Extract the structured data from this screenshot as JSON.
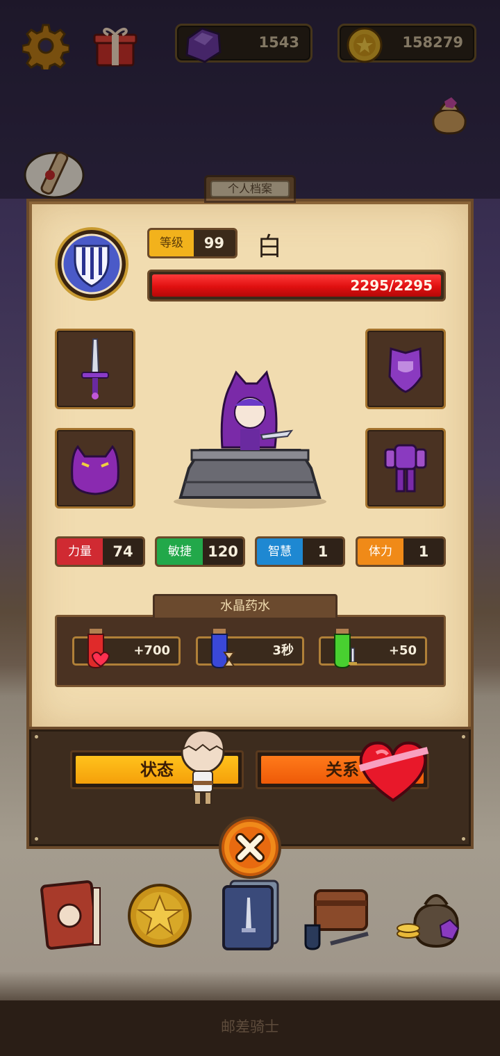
{
  "resources": {
    "gems": "1543",
    "coins": "158279"
  },
  "panel": {
    "tab_title": "个人档案"
  },
  "character": {
    "level_label": "等级",
    "level": "99",
    "name": "白",
    "hp_text": "2295/2295",
    "hp_fraction": 1.0
  },
  "stats": [
    {
      "label": "力量",
      "value": "74",
      "color": "#d02a32"
    },
    {
      "label": "敏捷",
      "value": "120",
      "color": "#22a84a"
    },
    {
      "label": "智慧",
      "value": "1",
      "color": "#1e88d2"
    },
    {
      "label": "体力",
      "value": "1",
      "color": "#f08a18"
    }
  ],
  "potions": {
    "title": "水晶药水",
    "items": [
      {
        "icon": "red-potion-heart-icon",
        "value": "+700"
      },
      {
        "icon": "blue-potion-hourglass-icon",
        "value": "3秒"
      },
      {
        "icon": "green-potion-sword-icon",
        "value": "+50"
      }
    ]
  },
  "buttons": {
    "status": "状态",
    "relation": "关系"
  },
  "footer": {
    "title": "邮差骑士"
  },
  "colors": {
    "panel_bg": "#f1dcb0",
    "frame": "#6b4a2a",
    "hp": "#e01010",
    "status_btn": "#f5a00a",
    "relation_btn": "#ee5a08"
  }
}
